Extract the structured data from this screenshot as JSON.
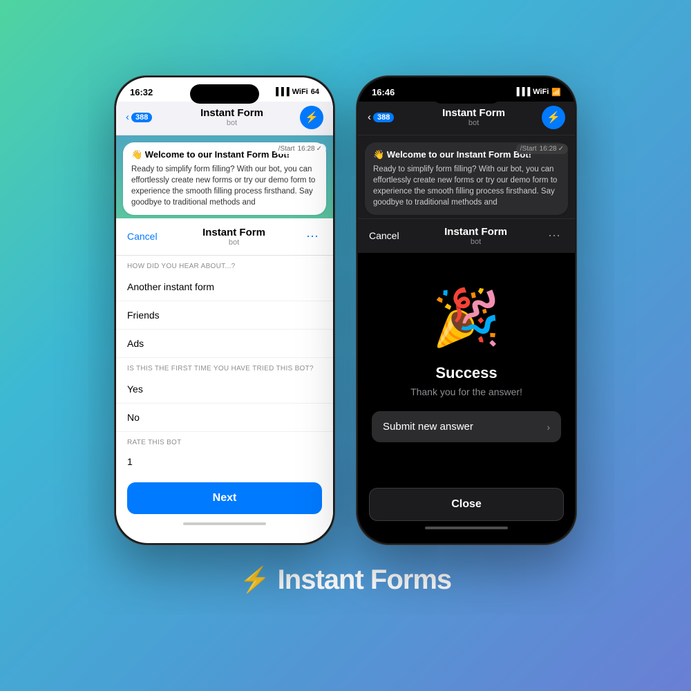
{
  "background": {
    "gradient": "linear-gradient(135deg, #4fd4a0 0%, #3db8d4 30%, #4a9fd4 60%, #6a7fd4 100%)"
  },
  "phone1": {
    "time": "16:32",
    "header": {
      "back_label": "388",
      "title": "Instant Form",
      "subtitle": "bot",
      "action_icon": "⚡"
    },
    "chat_bubble": {
      "greeting": "👋 Welcome to our Instant Form Bot!",
      "text": "Ready to simplify form filling? With our bot, you can effortlessly create new forms or try our demo form to experience the smooth filling process firsthand. Say goodbye to traditional methods and"
    },
    "start_label": "/Start",
    "start_time": "16:28",
    "form": {
      "cancel_label": "Cancel",
      "title": "Instant Form",
      "subtitle": "bot",
      "more_icon": "⋯",
      "section1_label": "HOW DID YOU HEAR ABOUT...?",
      "option1": "Another instant form",
      "option2": "Friends",
      "option3": "Ads",
      "section2_label": "IS THIS THE FIRST TIME YOU HAVE TRIED THIS BOT?",
      "option4": "Yes",
      "option5": "No",
      "section3_label": "RATE THIS BOT",
      "input_value": "1",
      "next_label": "Next"
    }
  },
  "phone2": {
    "time": "16:46",
    "header": {
      "back_label": "388",
      "title": "Instant Form",
      "subtitle": "bot",
      "action_icon": "⚡"
    },
    "chat_bubble": {
      "greeting": "👋 Welcome to our Instant Form Bot!",
      "text": "Ready to simplify form filling? With our bot, you can effortlessly create new forms or try our demo form to experience the smooth filling process firsthand. Say goodbye to traditional methods and"
    },
    "start_label": "/Start",
    "start_time": "16:28",
    "form": {
      "cancel_label": "Cancel",
      "title": "Instant Form",
      "subtitle": "bot",
      "more_icon": "⋯"
    },
    "success": {
      "icon": "🎉",
      "title": "Success",
      "subtitle": "Thank you for the answer!",
      "submit_label": "Submit new answer",
      "close_label": "Close"
    }
  },
  "branding": {
    "icon": "⚡",
    "text": "Instant Forms"
  }
}
